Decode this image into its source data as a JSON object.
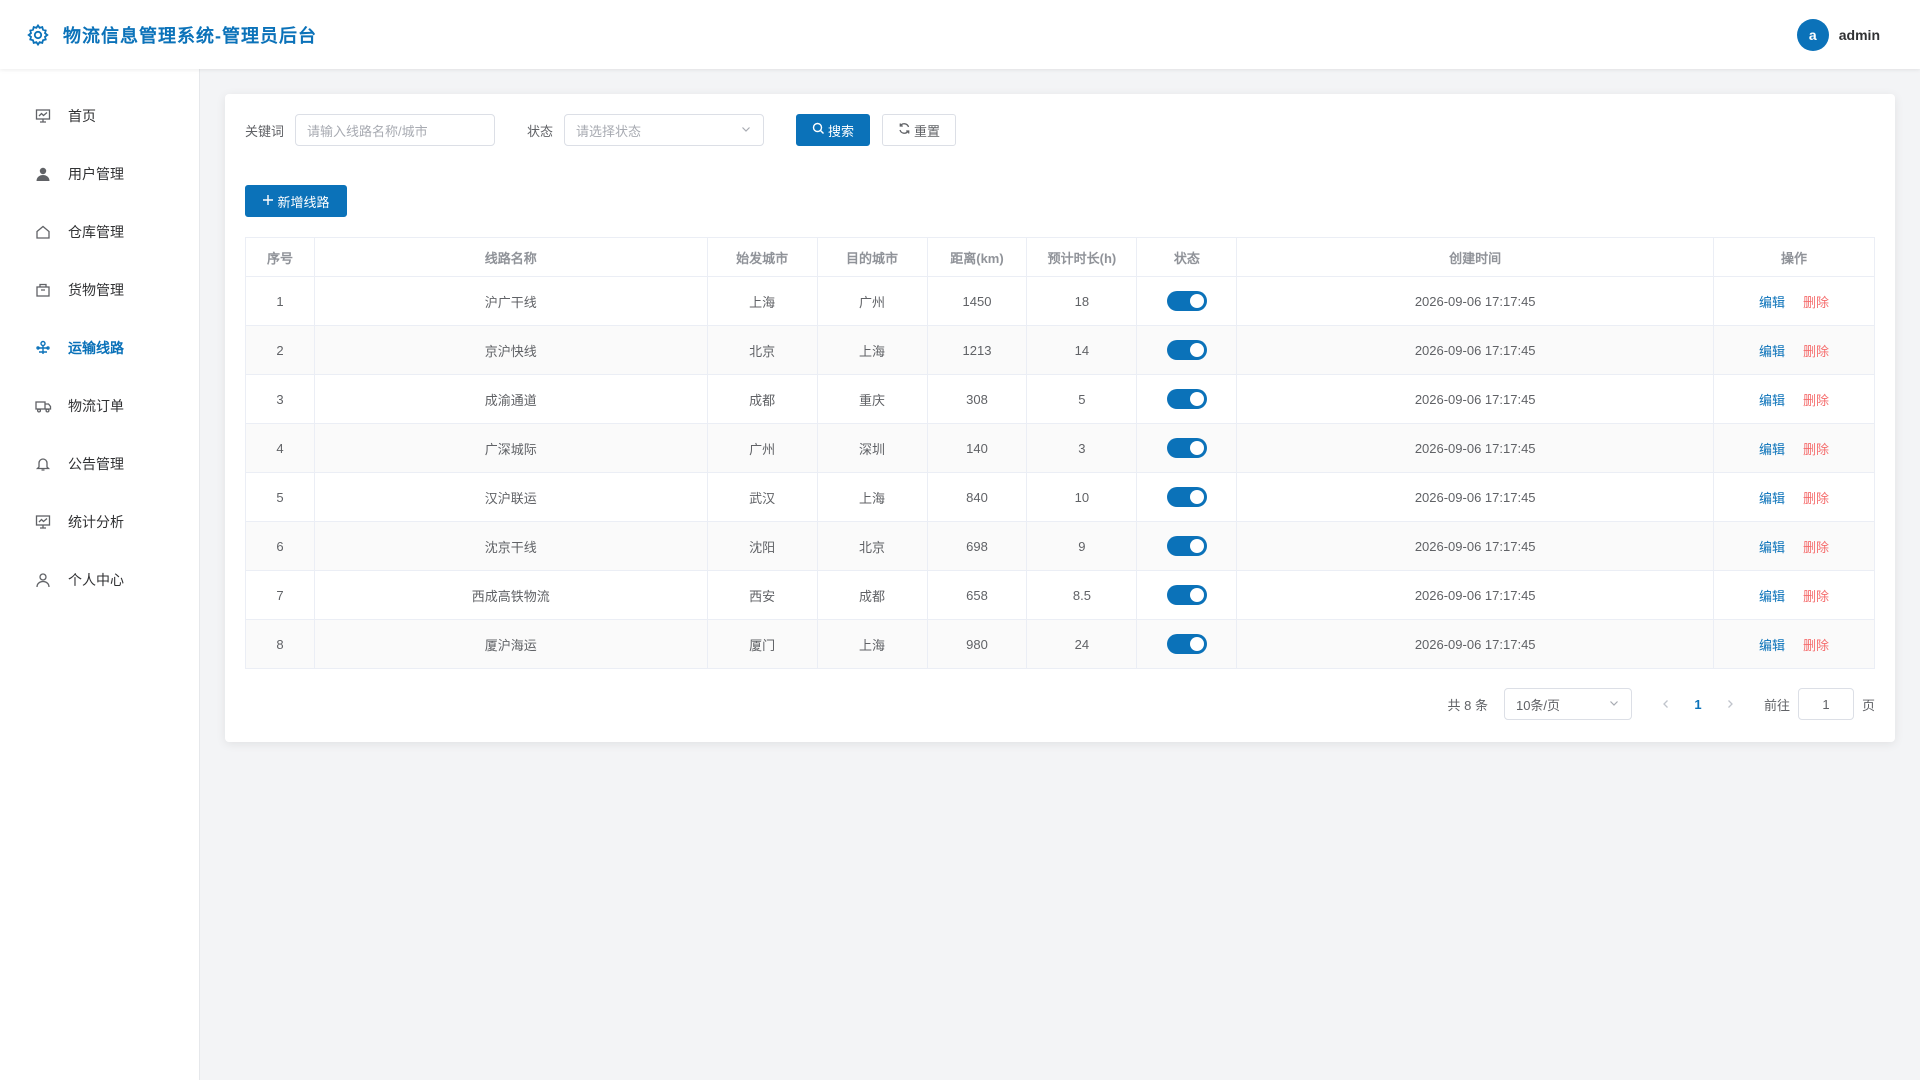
{
  "header": {
    "title": "物流信息管理系统-管理员后台",
    "user_initial": "a",
    "username": "admin"
  },
  "colors": {
    "primary": "#0b72b9",
    "danger": "#f56c6c"
  },
  "sidebar": {
    "items": [
      {
        "label": "首页",
        "icon": "dashboard-icon"
      },
      {
        "label": "用户管理",
        "icon": "user-icon"
      },
      {
        "label": "仓库管理",
        "icon": "warehouse-icon"
      },
      {
        "label": "货物管理",
        "icon": "box-icon"
      },
      {
        "label": "运输线路",
        "icon": "route-icon",
        "active": true
      },
      {
        "label": "物流订单",
        "icon": "truck-icon"
      },
      {
        "label": "公告管理",
        "icon": "bell-icon"
      },
      {
        "label": "统计分析",
        "icon": "chart-icon"
      },
      {
        "label": "个人中心",
        "icon": "profile-icon"
      }
    ]
  },
  "filters": {
    "keyword_label": "关键词",
    "keyword_placeholder": "请输入线路名称/城市",
    "status_label": "状态",
    "status_placeholder": "请选择状态",
    "search_label": "搜索",
    "reset_label": "重置"
  },
  "toolbar": {
    "add_label": "新增线路"
  },
  "table": {
    "columns": [
      "序号",
      "线路名称",
      "始发城市",
      "目的城市",
      "距离(km)",
      "预计时长(h)",
      "状态",
      "创建时间",
      "操作"
    ],
    "edit_label": "编辑",
    "delete_label": "删除",
    "rows": [
      {
        "index": "1",
        "name": "沪广干线",
        "from": "上海",
        "to": "广州",
        "distance": "1450",
        "hours": "18",
        "enabled": true,
        "created": "2026-09-06 17:17:45"
      },
      {
        "index": "2",
        "name": "京沪快线",
        "from": "北京",
        "to": "上海",
        "distance": "1213",
        "hours": "14",
        "enabled": true,
        "created": "2026-09-06 17:17:45"
      },
      {
        "index": "3",
        "name": "成渝通道",
        "from": "成都",
        "to": "重庆",
        "distance": "308",
        "hours": "5",
        "enabled": true,
        "created": "2026-09-06 17:17:45"
      },
      {
        "index": "4",
        "name": "广深城际",
        "from": "广州",
        "to": "深圳",
        "distance": "140",
        "hours": "3",
        "enabled": true,
        "created": "2026-09-06 17:17:45"
      },
      {
        "index": "5",
        "name": "汉沪联运",
        "from": "武汉",
        "to": "上海",
        "distance": "840",
        "hours": "10",
        "enabled": true,
        "created": "2026-09-06 17:17:45"
      },
      {
        "index": "6",
        "name": "沈京干线",
        "from": "沈阳",
        "to": "北京",
        "distance": "698",
        "hours": "9",
        "enabled": true,
        "created": "2026-09-06 17:17:45"
      },
      {
        "index": "7",
        "name": "西成高铁物流",
        "from": "西安",
        "to": "成都",
        "distance": "658",
        "hours": "8.5",
        "enabled": true,
        "created": "2026-09-06 17:17:45"
      },
      {
        "index": "8",
        "name": "厦沪海运",
        "from": "厦门",
        "to": "上海",
        "distance": "980",
        "hours": "24",
        "enabled": true,
        "created": "2026-09-06 17:17:45"
      }
    ]
  },
  "pagination": {
    "total_text": "共 8 条",
    "page_size": "10条/页",
    "current_page": "1",
    "goto_label": "前往",
    "goto_value": "1",
    "page_suffix": "页"
  }
}
